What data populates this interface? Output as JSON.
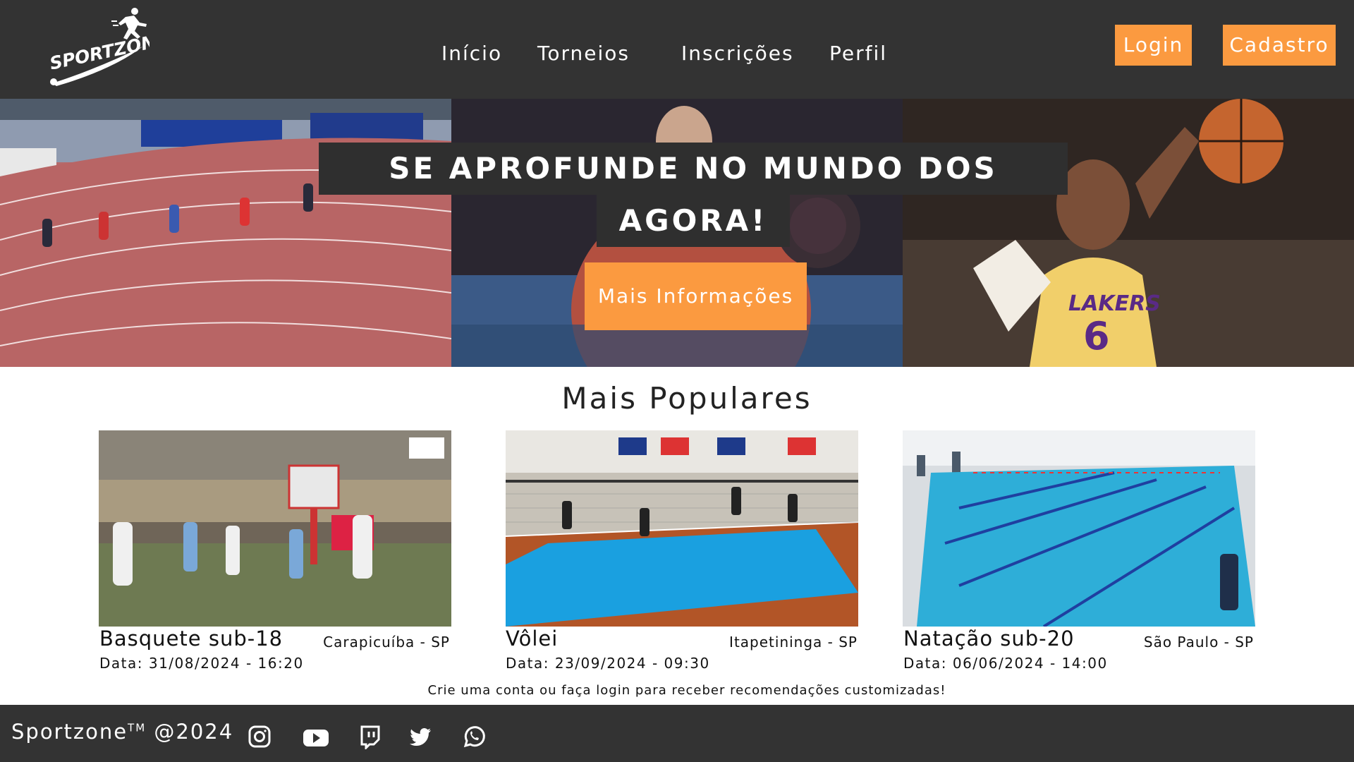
{
  "header": {
    "logo_text": "SPORTZONE",
    "nav": [
      "Início",
      "Torneios",
      "Inscrições",
      "Perfil"
    ],
    "login_label": "Login",
    "signup_label": "Cadastro"
  },
  "hero": {
    "title_line1": "SE APROFUNDE NO MUNDO DOS ESPORTES",
    "title_line2": "AGORA!",
    "cta_label": "Mais Informações"
  },
  "popular": {
    "title": "Mais Populares",
    "cards": [
      {
        "title": "Basquete sub-18",
        "location": "Carapicuíba - SP",
        "date": "Data: 31/08/2024  -  16:20"
      },
      {
        "title": "Vôlei",
        "location": "Itapetininga - SP",
        "date": "Data: 23/09/2024  -  09:30"
      },
      {
        "title": "Natação sub-20",
        "location": "São Paulo - SP",
        "date": "Data: 06/06/2024  -  14:00"
      }
    ],
    "tip": "Crie uma conta ou faça login para receber recomendações customizadas!"
  },
  "footer": {
    "brand": "Sportzone",
    "trademark": "TM",
    "year": "@2024",
    "socials": [
      "instagram-icon",
      "youtube-icon",
      "twitch-icon",
      "twitter-icon",
      "whatsapp-icon"
    ]
  },
  "colors": {
    "header_bg": "#333333",
    "accent": "#fb9a40",
    "hero_title_bg": "#2f2f2f"
  }
}
